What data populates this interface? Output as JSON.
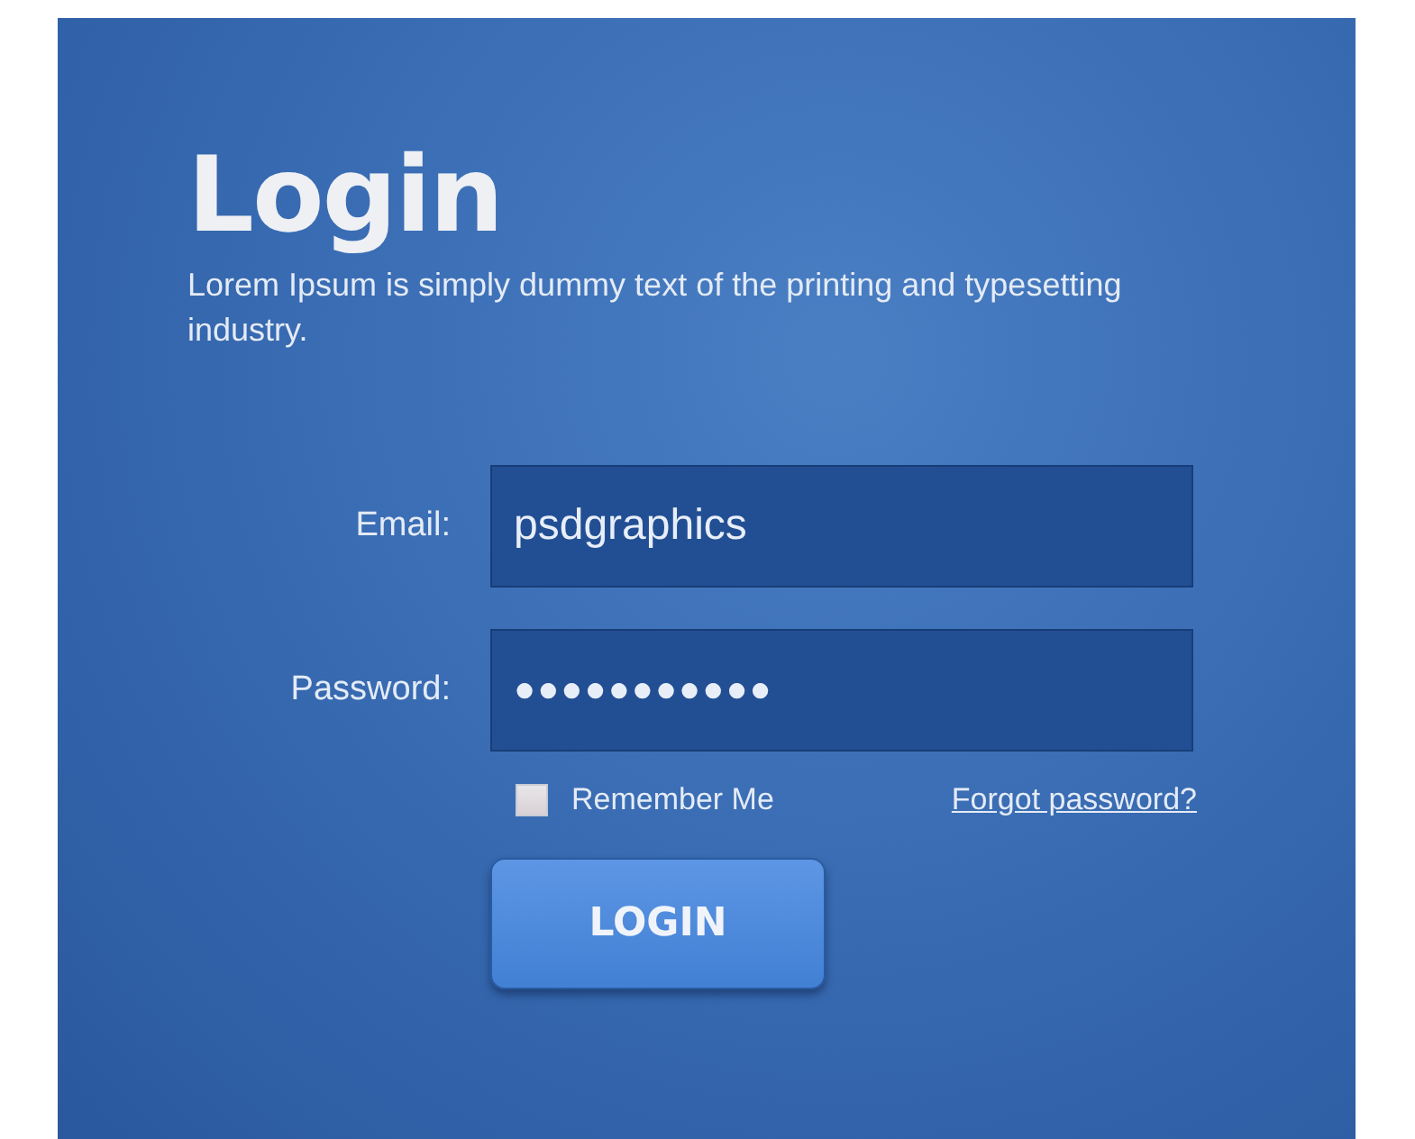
{
  "title": "Login",
  "subtitle": "Lorem Ipsum is simply dummy text of the printing and typesetting industry.",
  "fields": [
    {
      "label": "Email:",
      "value": "psdgraphics"
    },
    {
      "label": "Password:",
      "value": "●●●●●●●●●●●"
    }
  ],
  "remember": {
    "label": "Remember Me",
    "checked": false
  },
  "forgot_link": "Forgot password?",
  "login_button": "LOGIN"
}
